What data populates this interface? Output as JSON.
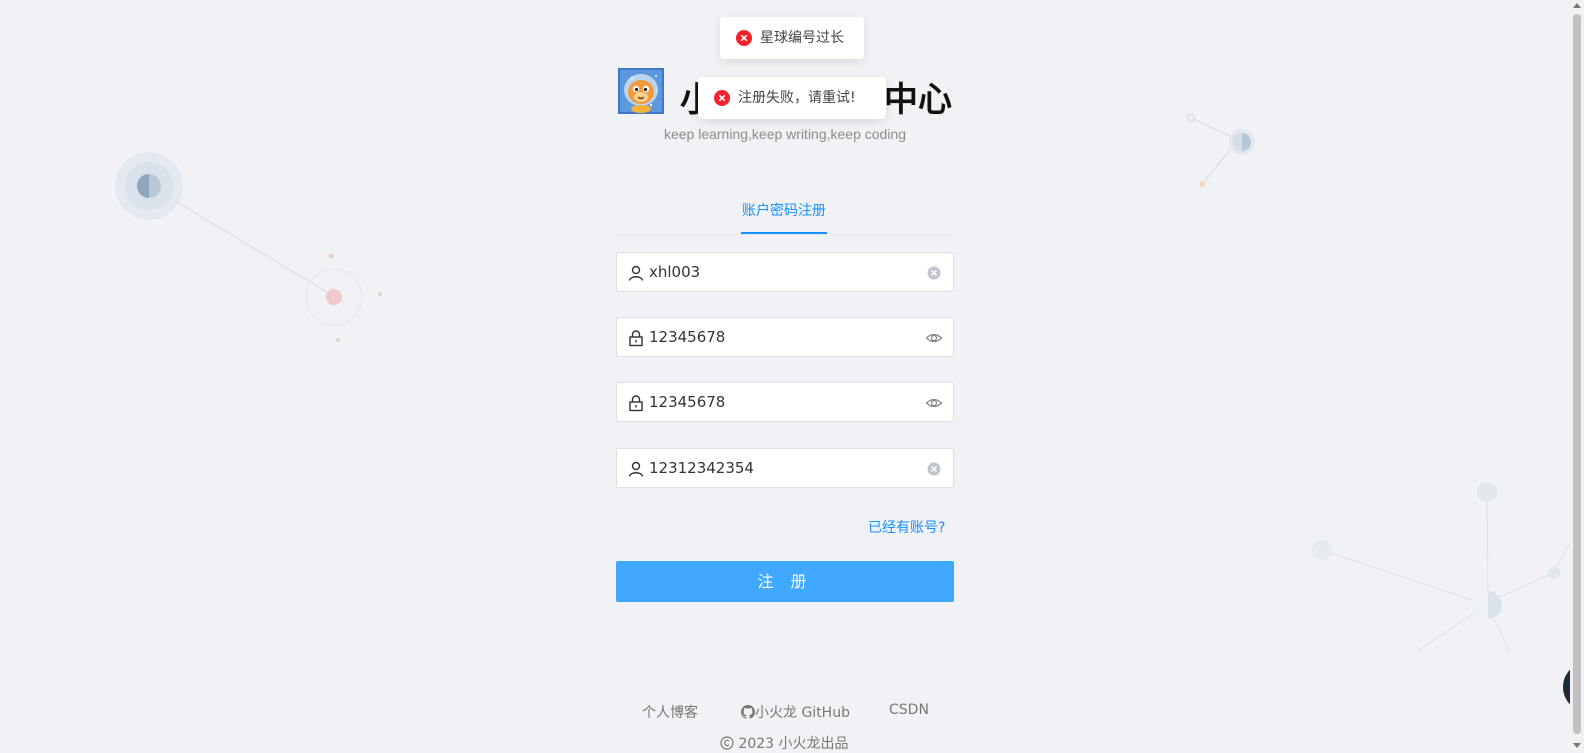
{
  "header": {
    "title_left": "小",
    "title_right": "中心",
    "subtitle": "keep learning,keep writing,keep coding"
  },
  "tabs": [
    {
      "label": "账户密码注册",
      "active": true
    }
  ],
  "form": {
    "username": "xhl003",
    "password": "12345678",
    "confirm_password": "12345678",
    "planet_code": "12312342354"
  },
  "links": {
    "has_account": "已经有账号?"
  },
  "submit_label": "注 册",
  "footer": {
    "links": [
      "个人博客",
      "小火龙 GitHub",
      "CSDN"
    ],
    "copyright": "2023 小火龙出品"
  },
  "toasts": [
    {
      "message": "星球编号过长",
      "type": "error"
    },
    {
      "message": "注册失败，请重试!",
      "type": "error"
    }
  ],
  "icons": {
    "user": "user-icon",
    "lock": "lock-icon",
    "clear": "clear-icon",
    "eye": "eye-icon",
    "github": "github-icon",
    "copyright": "copyright-icon",
    "error": "error-icon"
  },
  "colors": {
    "accent": "#1890ff",
    "button": "#40a9ff",
    "error": "#f5222d",
    "background": "#f0f2f5"
  }
}
